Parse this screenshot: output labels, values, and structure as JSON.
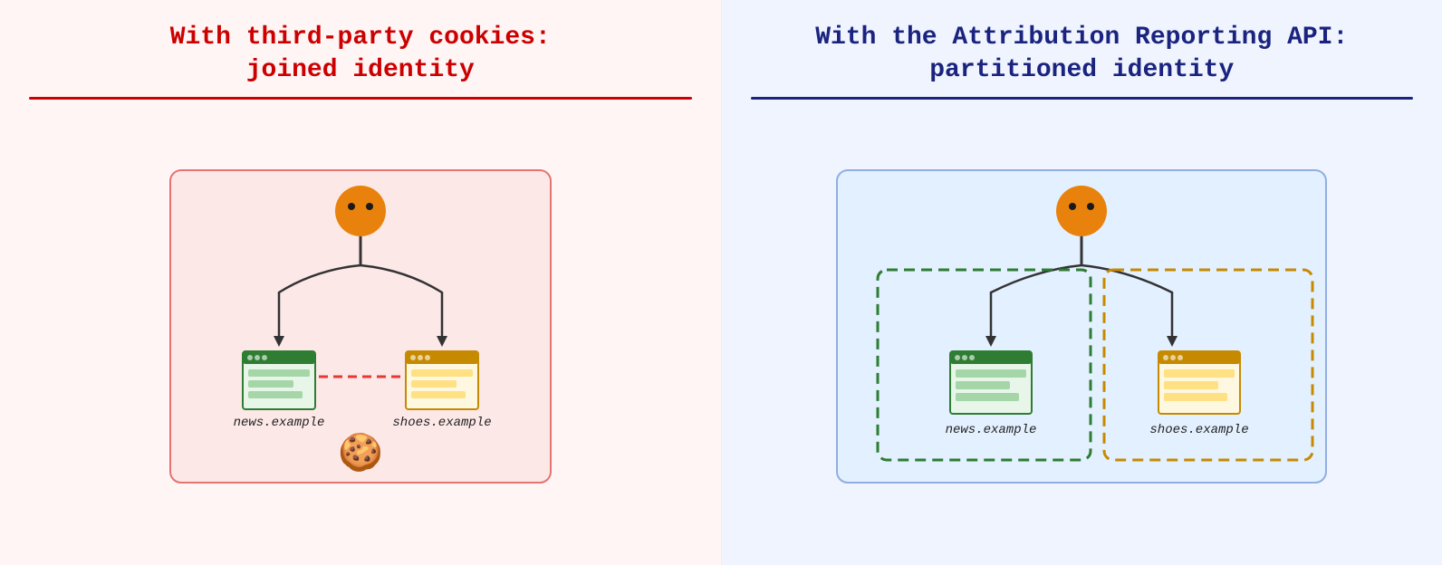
{
  "left": {
    "title_line1": "With third-party cookies:",
    "title_line2": "joined identity",
    "label_news": "news.example",
    "label_shoes": "shoes.example"
  },
  "right": {
    "title_line1": "With the Attribution Reporting API:",
    "title_line2": "partitioned identity",
    "label_news": "news.example",
    "label_shoes": "shoes.example"
  }
}
